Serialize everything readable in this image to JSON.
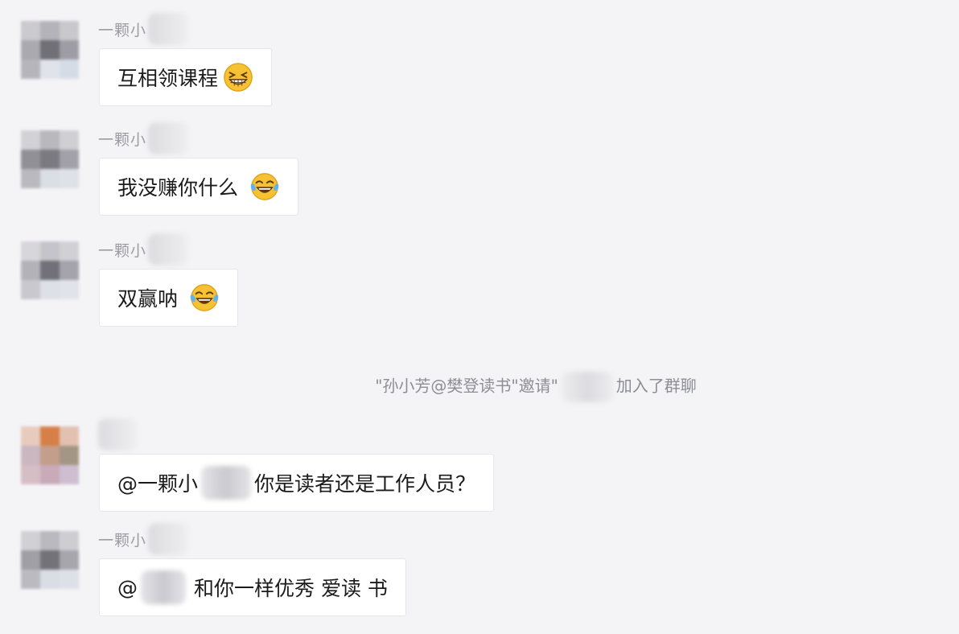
{
  "messages": [
    {
      "sender": "一颗小",
      "text": "互相领课程",
      "emoji": "grinning-squint-emoji",
      "avatar_colors": [
        "#c9c8cd",
        "#b1b0b6",
        "#c7c6cb",
        "#a7a6ad",
        "#6a6970",
        "#9a99a1",
        "#b3b2b9",
        "#dfe3ea",
        "#d4dbe6"
      ]
    },
    {
      "sender": "一颗小",
      "text": "我没赚你什么",
      "emoji": "tears-of-joy-emoji",
      "avatar_colors": [
        "#d1d0d5",
        "#b6b5bb",
        "#cfced3",
        "#8c8b92",
        "#75747b",
        "#9e9da5",
        "#b7b6bd",
        "#d9dde5",
        "#dde1e8"
      ]
    },
    {
      "sender": "一颗小",
      "text": "双赢呐",
      "emoji": "tears-of-joy-emoji",
      "avatar_colors": [
        "#d6d5da",
        "#c3c2c8",
        "#d0cfd4",
        "#b0afb6",
        "#6c6b73",
        "#a19fa7",
        "#c7c6cc",
        "#dcdfe6",
        "#e1e3ea"
      ]
    },
    {
      "sender": "",
      "text_before": "@一颗小",
      "text_after": "你是读者还是工作人员？",
      "avatar_colors": [
        "#e8c9bc",
        "#d57a3f",
        "#e2bfae",
        "#c8b4bd",
        "#c19a86",
        "#9f927e",
        "#d5bcc3",
        "#c6a7b5",
        "#ccbccd"
      ]
    },
    {
      "sender": "一颗小",
      "text_before": "@",
      "text_after": "和你一样优秀 爱读 书",
      "avatar_colors": [
        "#d0cfd4",
        "#b7b6bc",
        "#cdccd1",
        "#9c9ba2",
        "#6d6c73",
        "#a3a2aa",
        "#b9b8bf",
        "#d8dce4",
        "#dde0e7"
      ]
    }
  ],
  "system_notice": {
    "before": "\"孙小芳@樊登读书\"邀请\"",
    "after": "加入了群聊"
  }
}
